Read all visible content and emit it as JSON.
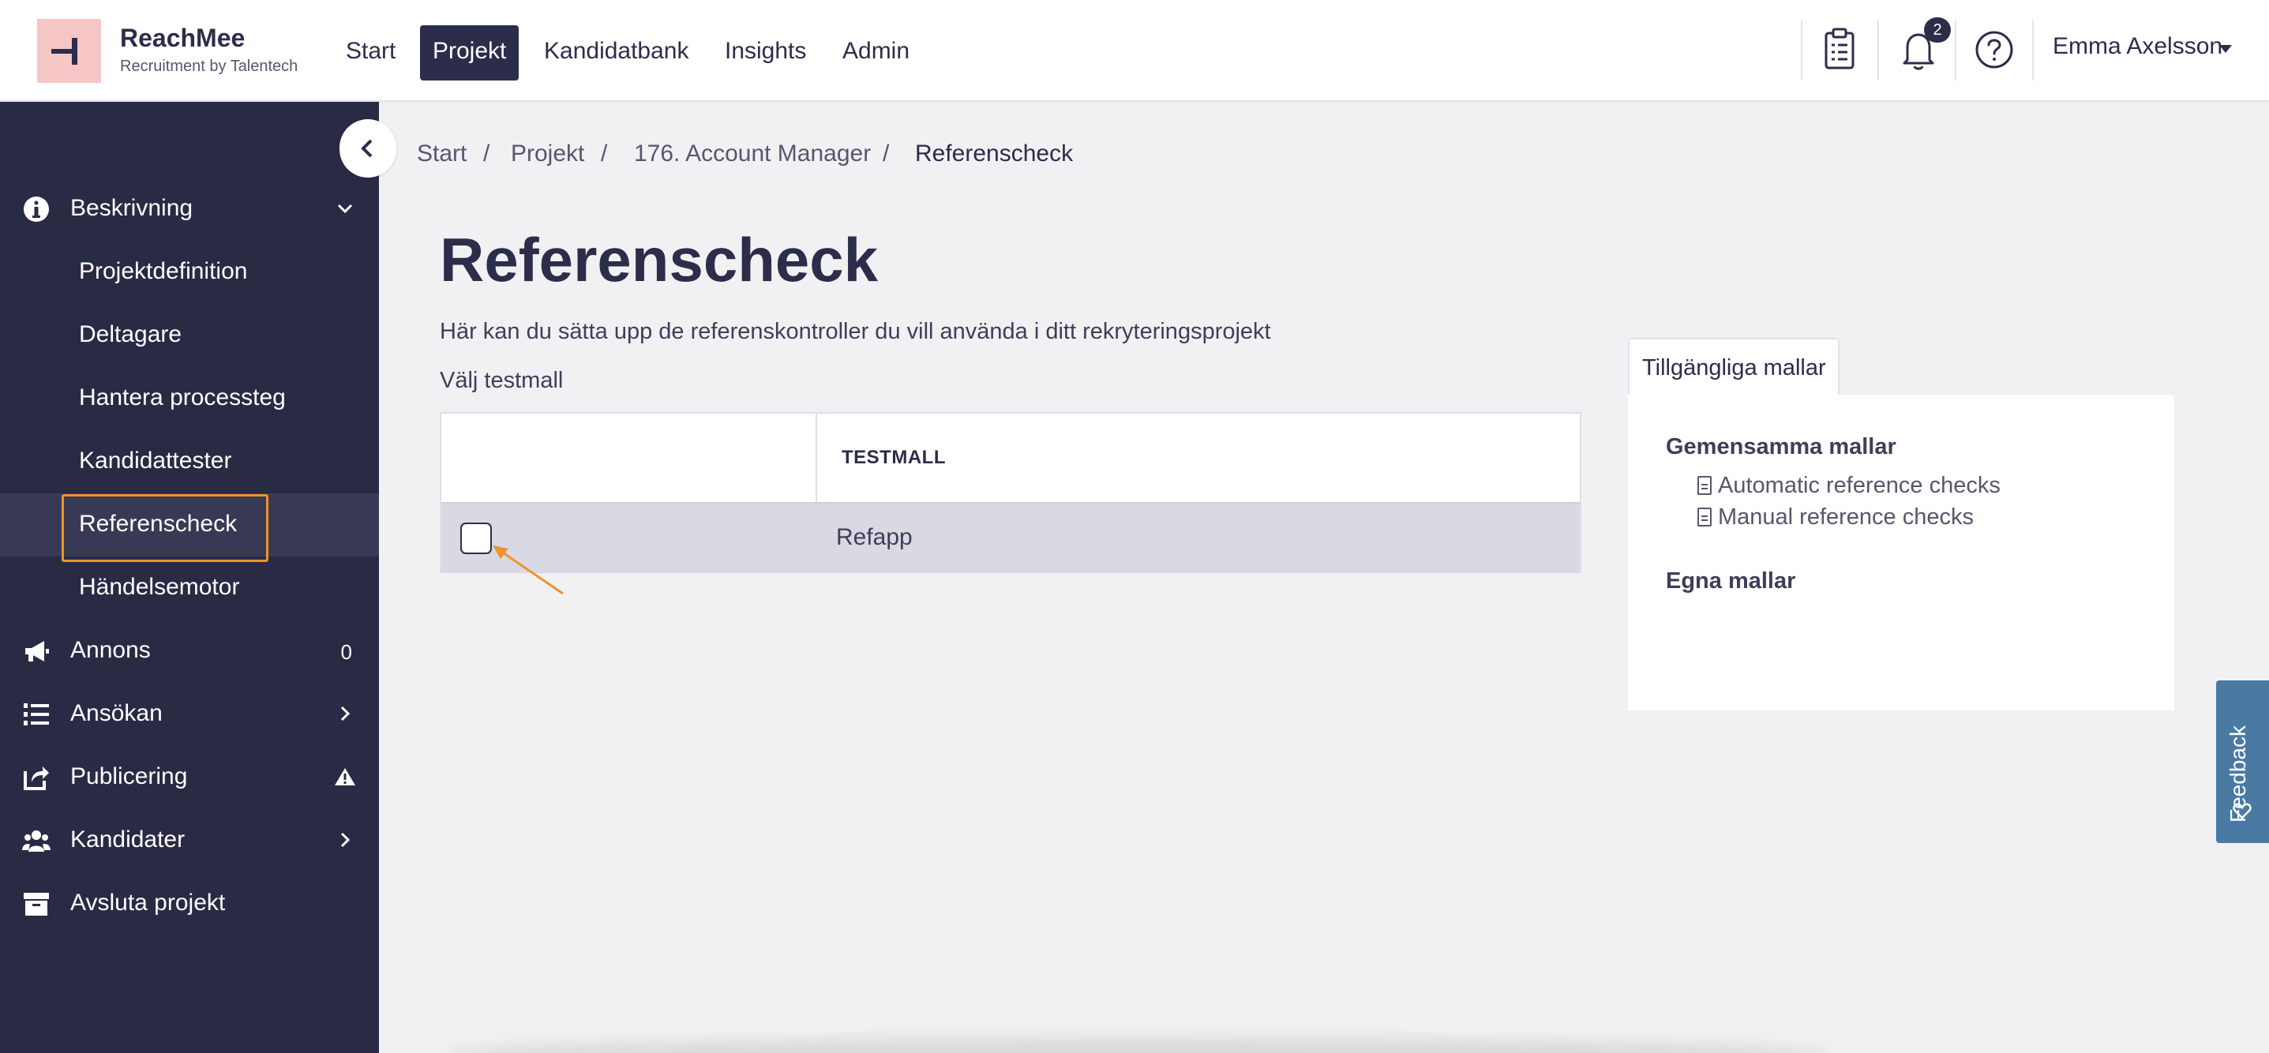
{
  "brand": {
    "name": "ReachMee",
    "tagline": "Recruitment by Talentech"
  },
  "nav": [
    {
      "label": "Start",
      "active": false
    },
    {
      "label": "Projekt",
      "active": true
    },
    {
      "label": "Kandidatbank",
      "active": false
    },
    {
      "label": "Insights",
      "active": false
    },
    {
      "label": "Admin",
      "active": false
    }
  ],
  "header": {
    "notification_count": "2",
    "user_name": "Emma Axelsson"
  },
  "sidebar": {
    "sections": [
      {
        "label": "Beskrivning",
        "icon": "info-circle-icon"
      },
      {
        "label": "Annons",
        "icon": "megaphone-icon",
        "count": "0"
      },
      {
        "label": "Ansökan",
        "icon": "numbered-list-icon"
      },
      {
        "label": "Publicering",
        "icon": "share-icon"
      },
      {
        "label": "Kandidater",
        "icon": "users-icon"
      },
      {
        "label": "Avsluta projekt",
        "icon": "archive-icon"
      }
    ],
    "subitems": [
      {
        "label": "Projektdefinition"
      },
      {
        "label": "Deltagare"
      },
      {
        "label": "Hantera processteg"
      },
      {
        "label": "Kandidattester"
      },
      {
        "label": "Referenscheck",
        "selected": true
      },
      {
        "label": "Händelsemotor"
      }
    ]
  },
  "breadcrumb": [
    "Start",
    "Projekt",
    "176. Account Manager",
    "Referenscheck"
  ],
  "breadcrumb_separator": "/",
  "page": {
    "title": "Referenscheck",
    "description": "Här kan du sätta upp de referenskontroller du vill använda i ditt rekryteringsprojekt",
    "select_label": "Välj testmall"
  },
  "table": {
    "column_header": "TESTMALL",
    "rows": [
      {
        "checked": false,
        "name": "Refapp"
      }
    ]
  },
  "templates_panel": {
    "tab_label": "Tillgängliga mallar",
    "common_heading": "Gemensamma mallar",
    "common_templates": [
      "Automatic reference checks",
      "Manual reference checks"
    ],
    "own_heading": "Egna mallar"
  },
  "feedback": {
    "label": "Feedback"
  },
  "colors": {
    "sidebar_bg": "#292b45",
    "primary": "#2b2d4a",
    "highlight": "#f0932b",
    "feedback_bg": "#4a7aa4",
    "logo_bg": "#f6c5c5"
  }
}
